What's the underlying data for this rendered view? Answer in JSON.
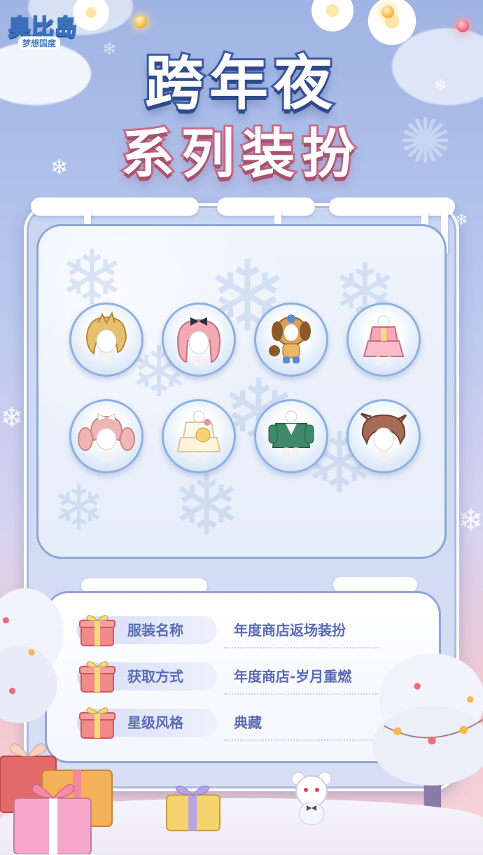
{
  "logo": {
    "main": "奥比岛",
    "sub": "梦想国度"
  },
  "title": {
    "line1": "跨年夜",
    "line2": "系列装扮"
  },
  "items": [
    {
      "icon": "blonde-hair-icon"
    },
    {
      "icon": "pink-hair-bow-icon"
    },
    {
      "icon": "puppy-costume-icon"
    },
    {
      "icon": "pink-dress-icon"
    },
    {
      "icon": "pink-twintail-hair-icon"
    },
    {
      "icon": "lolita-dress-icon"
    },
    {
      "icon": "green-jacket-outfit-icon"
    },
    {
      "icon": "brown-hair-icon"
    }
  ],
  "info": [
    {
      "label": "服装名称",
      "value": "年度商店返场装扮",
      "icon": "gift-icon"
    },
    {
      "label": "获取方式",
      "value": "年度商店-岁月重燃",
      "icon": "gift-icon"
    },
    {
      "label": "星级风格",
      "value": "典藏",
      "icon": "gift-icon"
    }
  ],
  "colors": {
    "accent": "#5a6bb8",
    "frame": "#8fa6d8",
    "title_stroke": "#3f5da6",
    "subtitle_stroke": "#c96f8e"
  }
}
